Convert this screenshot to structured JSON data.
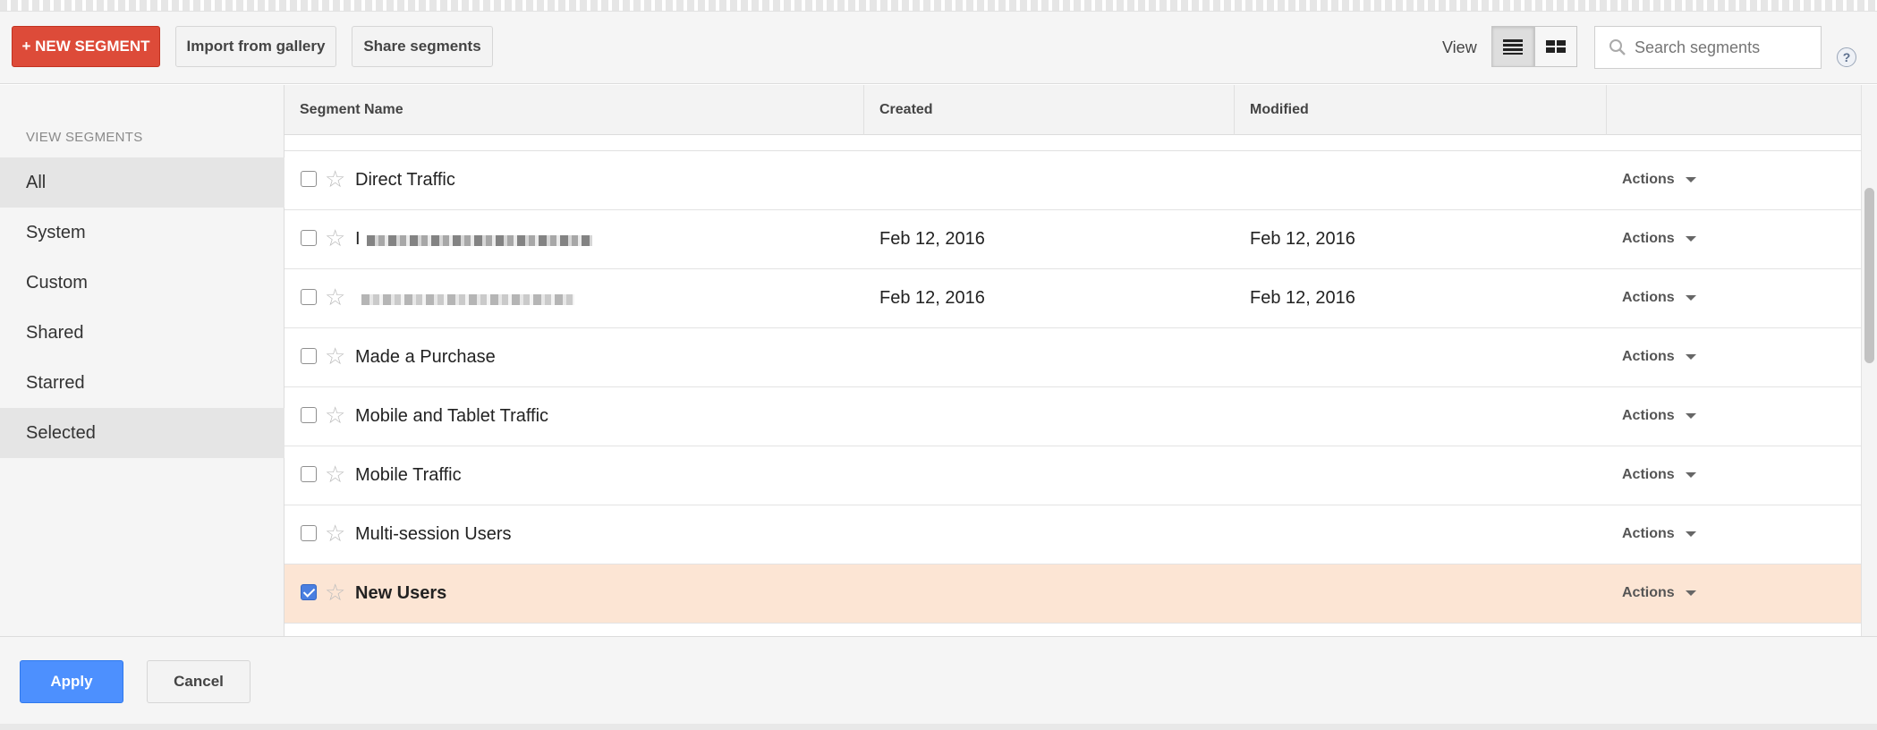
{
  "toolbar": {
    "new_segment_label": "+ NEW SEGMENT",
    "import_label": "Import from gallery",
    "share_label": "Share segments",
    "view_label": "View",
    "search_placeholder": "Search segments",
    "help_label": "?"
  },
  "sidebar": {
    "heading": "VIEW SEGMENTS",
    "items": [
      {
        "label": "All",
        "selected": true
      },
      {
        "label": "System",
        "selected": false
      },
      {
        "label": "Custom",
        "selected": false
      },
      {
        "label": "Shared",
        "selected": false
      },
      {
        "label": "Starred",
        "selected": false
      },
      {
        "label": "Selected",
        "selected": true
      }
    ]
  },
  "table": {
    "columns": [
      "Segment Name",
      "Created",
      "Modified",
      ""
    ],
    "rows": [
      {
        "name": "Direct Traffic",
        "created": "",
        "modified": "",
        "actions": "Actions",
        "checked": false
      },
      {
        "name": "I",
        "created": "Feb 12, 2016",
        "modified": "Feb 12, 2016",
        "actions": "Actions",
        "checked": false,
        "redacted": true
      },
      {
        "name": "",
        "created": "Feb 12, 2016",
        "modified": "Feb 12, 2016",
        "actions": "Actions",
        "checked": false,
        "redacted": true
      },
      {
        "name": "Made a Purchase",
        "created": "",
        "modified": "",
        "actions": "Actions",
        "checked": false
      },
      {
        "name": "Mobile and Tablet Traffic",
        "created": "",
        "modified": "",
        "actions": "Actions",
        "checked": false
      },
      {
        "name": "Mobile Traffic",
        "created": "",
        "modified": "",
        "actions": "Actions",
        "checked": false
      },
      {
        "name": "Multi-session Users",
        "created": "",
        "modified": "",
        "actions": "Actions",
        "checked": false
      },
      {
        "name": "New Users",
        "created": "",
        "modified": "",
        "actions": "Actions",
        "checked": true
      }
    ]
  },
  "footer": {
    "apply_label": "Apply",
    "cancel_label": "Cancel"
  },
  "colors": {
    "accent_red": "#dd4b39",
    "apply_blue": "#4d90fe",
    "checked_row": "#fce5d4"
  }
}
